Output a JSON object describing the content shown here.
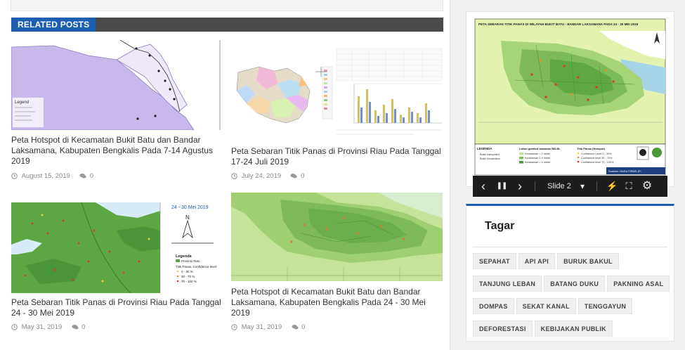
{
  "related": {
    "heading": "RELATED POSTS",
    "posts": [
      {
        "title": "Peta Hotspot di Kecamatan Bukit Batu dan Bandar Laksamana, Kabupaten Bengkalis Pada 7-14 Agustus 2019",
        "date": "August 15, 2019",
        "comments": "0",
        "thumb_map_label": "Legend"
      },
      {
        "title": "Peta Sebaran Titik Panas di Provinsi Riau Pada Tanggal 17-24 Juli 2019",
        "date": "July 24, 2019",
        "comments": "0"
      },
      {
        "title": "Peta Sebaran Titik Panas di Provinsi Riau Pada Tanggal 24 - 30 Mei 2019",
        "date": "May 31, 2019",
        "comments": "0",
        "thumb_date": "24 - 30 Mei 2019",
        "thumb_north": "N",
        "thumb_legend": [
          "Legenda",
          "Provinsi Riau",
          "Titik Panas. Confidence level:",
          "0 - 30 %",
          "30 - 70 %",
          "70 - 100 %"
        ]
      },
      {
        "title": "Peta Hotspot di Kecamatan Bukit Batu dan Bandar Laksamana, Kabupaten Bengkalis Pada 24 - 30 Mei 2019",
        "date": "May 31, 2019",
        "comments": "0"
      }
    ]
  },
  "slider": {
    "map_title": "PETA SEBARAN TITIK PANAS DI WILAYAH BUKIT BATU - BANDAR LAKSAMANA PADA 24 - 30 MEI 2019",
    "legend_heading": "LEGENDA",
    "legend_items": [
      "Bukit Kabupaten",
      "Bukit Kecamatan"
    ],
    "peat_heading": "Lahan gambut kawasan BB-BL",
    "peat_items": [
      "Kedalaman < 2 meter",
      "Kedalaman 2-4 meter",
      "Kedalaman > 4 meter"
    ],
    "hotspot_heading": "Titik Panas (Hotspot)",
    "hotspot_items": [
      "Confidence Level 0 - 30%",
      "Confidence level 30 - 70%",
      "Confidence level 70 - 100%"
    ],
    "source": "Sumber: NASA FIRMS (FI",
    "slide_label": "Slide 2",
    "icons": {
      "prev": "‹",
      "pause": "❚❚",
      "next": "›",
      "dropdown": "▾",
      "bolt": "⚡",
      "fullscreen": "⛶",
      "settings": "⚙"
    }
  },
  "tags": {
    "heading": "Tagar",
    "items": [
      "SEPAHAT",
      "API API",
      "BURUK BAKUL",
      "TANJUNG LEBAN",
      "BATANG DUKU",
      "PAKNING ASAL",
      "DOMPAS",
      "SEKAT KANAL",
      "TENGGAYUN",
      "DEFORESTASI",
      "KEBIJAKAN PUBLIK"
    ]
  },
  "colors": {
    "accent": "#1c5fb0",
    "header_bar": "#4a4a4a",
    "map_green": "#7dbb5a",
    "map_light_green": "#c7e39a",
    "map_water": "#b8d8f0"
  }
}
